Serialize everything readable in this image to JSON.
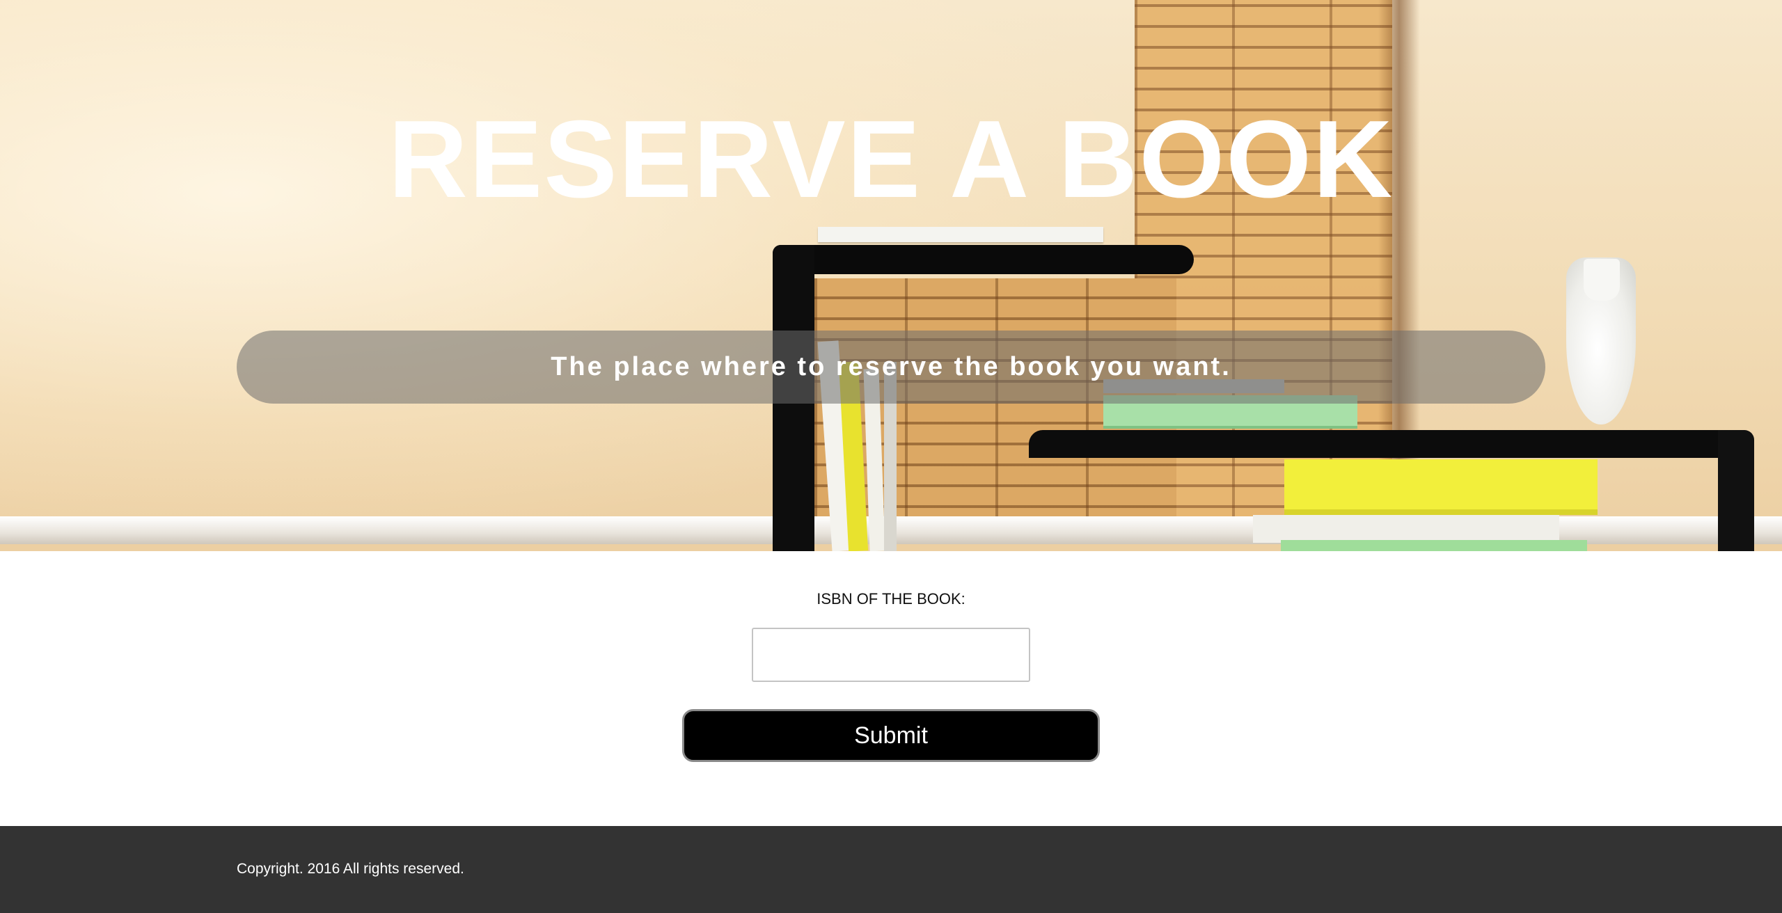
{
  "hero": {
    "title": "RESERVE A BOOK",
    "tagline": "The place where to reserve the book you want."
  },
  "form": {
    "isbn_label": "ISBN OF THE BOOK:",
    "isbn_value": "",
    "isbn_placeholder": "",
    "submit_label": "Submit"
  },
  "footer": {
    "copyright": "Copyright. 2016 All rights reserved."
  },
  "colors": {
    "submit_bg": "#000000",
    "footer_bg": "#333333",
    "title_text": "#ffffff"
  }
}
